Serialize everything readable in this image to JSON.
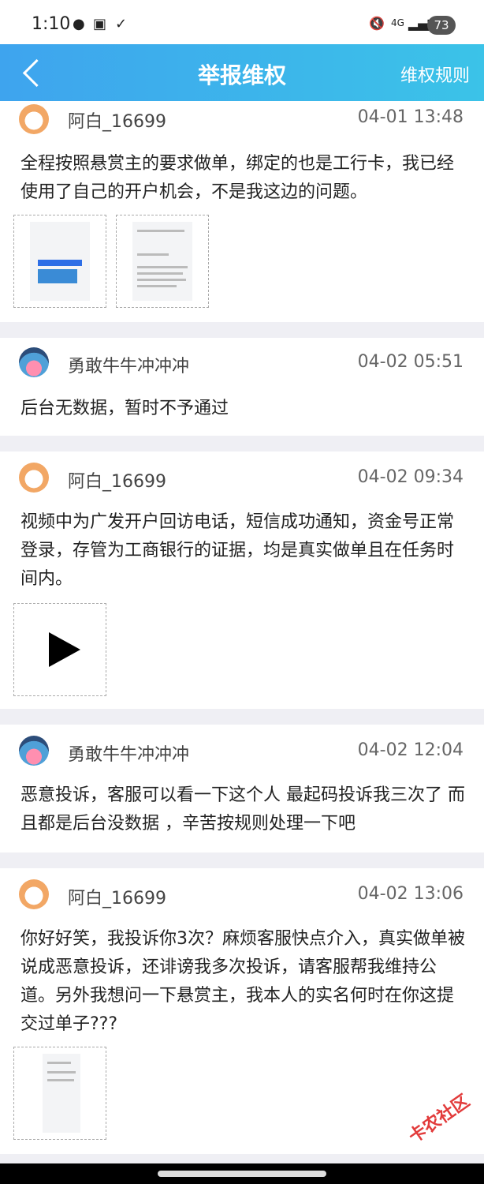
{
  "status_bar": {
    "time": "1:10",
    "battery": "73",
    "net": "4G"
  },
  "header": {
    "title": "举报维权",
    "rules_label": "维权规则"
  },
  "posts": [
    {
      "user": "阿白_16699",
      "time": "04-01 13:48",
      "text": "全程按照悬赏主的要求做单，绑定的也是工行卡，我已经使用了自己的开户机会，不是我这边的问题。"
    },
    {
      "user": "勇敢牛牛冲冲冲",
      "time": "04-02 05:51",
      "text": "后台无数据，暂时不予通过"
    },
    {
      "user": "阿白_16699",
      "time": "04-02 09:34",
      "text": "视频中为广发开户回访电话，短信成功通知，资金号正常登录，存管为工商银行的证据，均是真实做单且在任务时间内。"
    },
    {
      "user": "勇敢牛牛冲冲冲",
      "time": "04-02 12:04",
      "text": "恶意投诉，客服可以看一下这个人 最起码投诉我三次了 而且都是后台没数据 ，辛苦按规则处理一下吧"
    },
    {
      "user": "阿白_16699",
      "time": "04-02 13:06",
      "text": "你好好笑，我投诉你3次？麻烦客服快点介入，真实做单被说成恶意投诉，还诽谤我多次投诉，请客服帮我维持公道。另外我想问一下悬赏主，我本人的实名何时在你这提交过单子???"
    }
  ],
  "watermark": "卡农社区"
}
